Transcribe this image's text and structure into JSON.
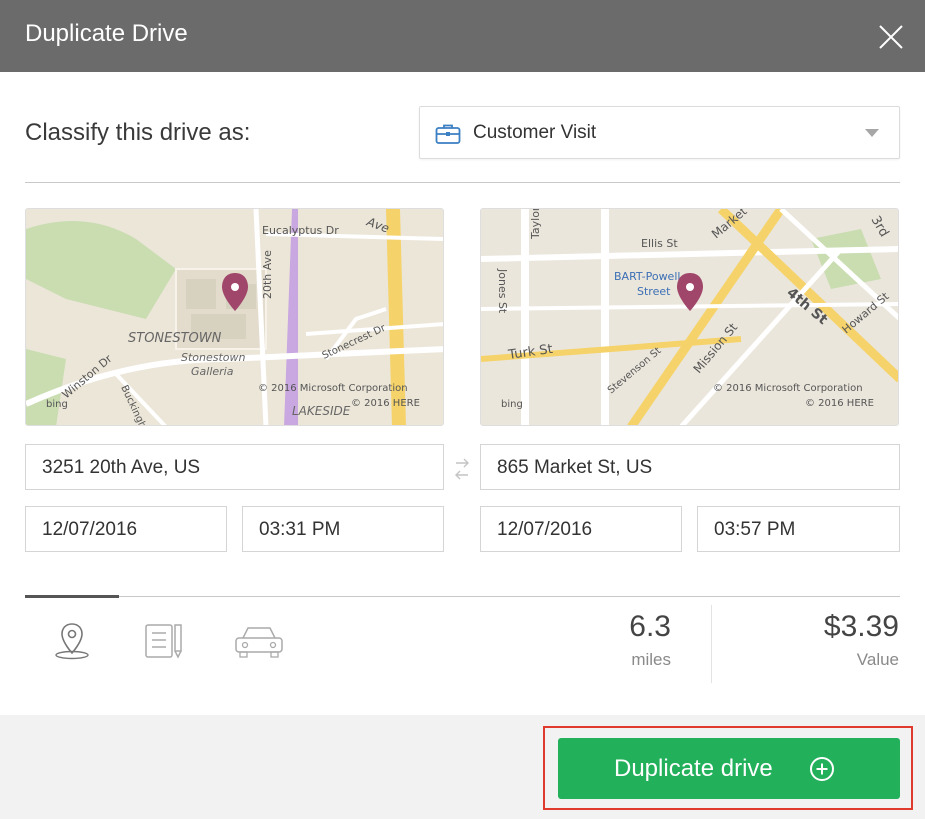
{
  "dialog": {
    "title": "Duplicate Drive"
  },
  "classify": {
    "label": "Classify this drive as:",
    "selected": "Customer Visit",
    "icon": "briefcase-icon"
  },
  "maps": {
    "start": {
      "labels": {
        "street1": "Eucalyptus Dr",
        "street2": "20th Ave",
        "street3": "Ave",
        "street4": "Winston Dr",
        "street5": "Buckingham",
        "street6": "Stonecrest Dr",
        "area": "STONESTOWN",
        "area2a": "Stonestown",
        "area2b": "Galleria",
        "area3": "LAKESIDE",
        "copyright1": "© 2016 Microsoft Corporation",
        "copyright2": "© 2016 HERE",
        "brand": "bing"
      }
    },
    "end": {
      "labels": {
        "street1": "Ellis St",
        "street2": "Market",
        "street3": "Jones St",
        "street4": "Turk St",
        "street5": "Stevenson St",
        "street6": "Mission St",
        "street7": "4th St",
        "street8": "Howard St",
        "street9": "3rd",
        "street10": "Taylor St",
        "poi1": "BART-Powell",
        "poi2": "Street",
        "copyright1": "© 2016 Microsoft Corporation",
        "copyright2": "© 2016 HERE",
        "brand": "bing"
      }
    }
  },
  "start": {
    "address": "3251 20th Ave, US",
    "date": "12/07/2016",
    "time": "03:31 PM"
  },
  "end": {
    "address": "865 Market St, US",
    "date": "12/07/2016",
    "time": "03:57 PM"
  },
  "tabs": [
    "location-pin-icon",
    "notes-icon",
    "car-icon"
  ],
  "stats": {
    "distance": "6.3",
    "distance_unit": "miles",
    "value": "$3.39",
    "value_label": "Value"
  },
  "actions": {
    "duplicate": "Duplicate drive"
  },
  "colors": {
    "header": "#6b6b6b",
    "primary": "#22b05b",
    "highlight": "#e03a2f",
    "pin": "#a0466a"
  }
}
